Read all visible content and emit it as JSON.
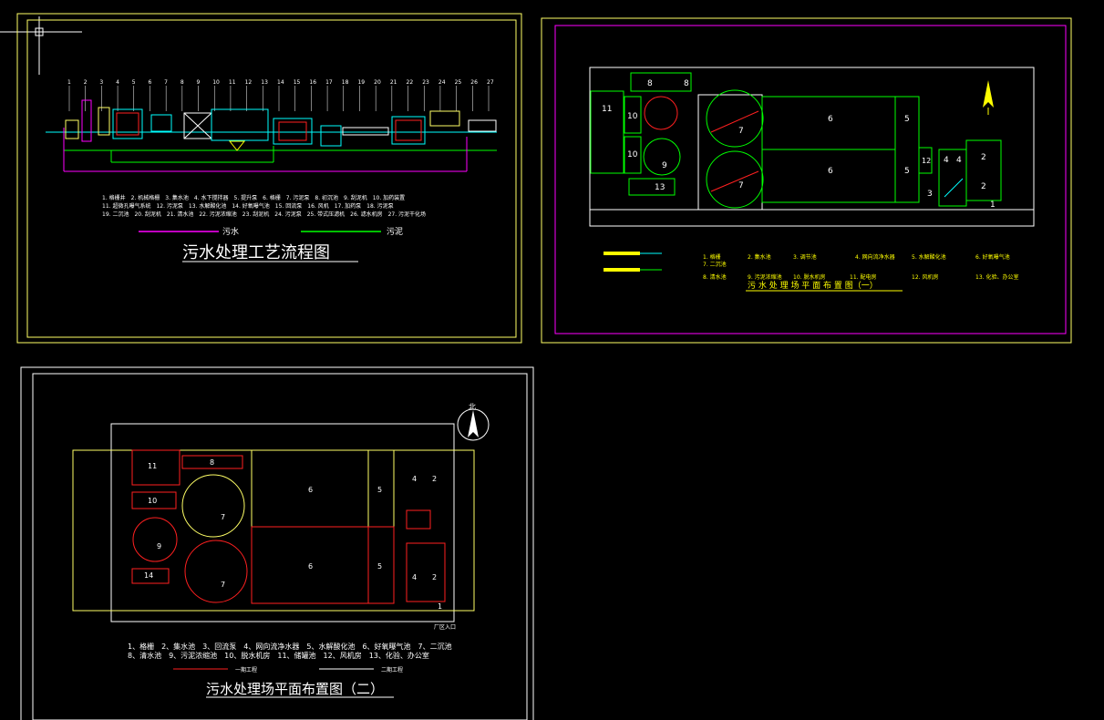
{
  "colors": {
    "background": "#000000",
    "frame": "#ffff66",
    "title_text": "#ffffff",
    "magenta": "#ff00ff",
    "green": "#00ff00",
    "cyan": "#00ffff",
    "red": "#ff2020",
    "yellow": "#ffff00"
  },
  "drawing1": {
    "title": "污水处理工艺流程图",
    "numbers_top": [
      "1",
      "2",
      "3",
      "4",
      "5",
      "6",
      "7",
      "8",
      "9",
      "10",
      "11",
      "12",
      "13",
      "14",
      "15",
      "16",
      "17",
      "18",
      "19",
      "20",
      "21",
      "22",
      "23",
      "24",
      "25",
      "26",
      "27"
    ],
    "legend_rows": [
      "1. 格栅井　2. 机械格栅　3. 集水池　4. 水下搅拌器　5. 提升泵　6. 格栅　7. 污泥泵　8. 初沉池　9. 刮泥机　10. 加药装置",
      "11. 超微孔曝气系统　12. 污泥泵　13. 水解酸化池　14. 好氧曝气池　15. 回流泵　16. 风机　17. 加药泵　18. 污泥泵",
      "19. 二沉池　20. 刮泥机　21. 清水池　22. 污泥浓缩池　23. 刮泥机　24. 污泥泵　25. 带式压滤机　26. 滤水机房　27. 污泥干化场"
    ],
    "line_legend": {
      "sewage": "污水",
      "sludge": "污泥"
    }
  },
  "drawing2": {
    "title": "污 水 处 理 场 平 面 布 置 图（一）",
    "tank_labels": {
      "t8a": "8",
      "t8b": "8",
      "t11": "11",
      "t10a": "10",
      "t10b": "10",
      "t9": "9",
      "t13": "13",
      "t7a": "7",
      "t7b": "7",
      "t6a": "6",
      "t6b": "6",
      "t5a": "5",
      "t5b": "5",
      "t12": "12",
      "t4a": "4",
      "t4b": "4",
      "t2a": "2",
      "t2b": "2",
      "t3": "3",
      "t1": "1"
    },
    "legend_row1": [
      "1. 格栅",
      "2. 集水池",
      "3. 调节池",
      "4. 网向流净水器",
      "5. 水解酸化池",
      "6. 好氧曝气池"
    ],
    "legend_row1b": "7. 二沉池",
    "legend_row2": [
      "8. 清水池",
      "9. 污泥浓缩池",
      "10. 脱水机房",
      "11. 配电房",
      "12. 风机房",
      "13. 化验、办公室"
    ]
  },
  "drawing3": {
    "title": "污水处理场平面布置图（二）",
    "north_label": "北",
    "tank_labels": {
      "t11": "11",
      "t10": "10",
      "t9": "9",
      "t14": "14",
      "t8": "8",
      "t7a": "7",
      "t7b": "7",
      "t6a": "6",
      "t6b": "6",
      "t5a": "5",
      "t5b": "5",
      "t4a": "4",
      "t2a": "2",
      "t4b": "4",
      "t2b": "2",
      "t1": "1"
    },
    "entrance_label": "厂区入口",
    "legend_row1": "1、格栅　2、集水池　3、回流泵　4、网向流净水器　5、水解酸化池　6、好氧曝气池　7、二沉池",
    "legend_row2": "8、清水池　9、污泥浓缩池　10、脱水机房　11、储罐池　12、风机房　13、化验、办公室",
    "line_legend": {
      "phase1": "一期工程",
      "phase2": "二期工程"
    }
  }
}
